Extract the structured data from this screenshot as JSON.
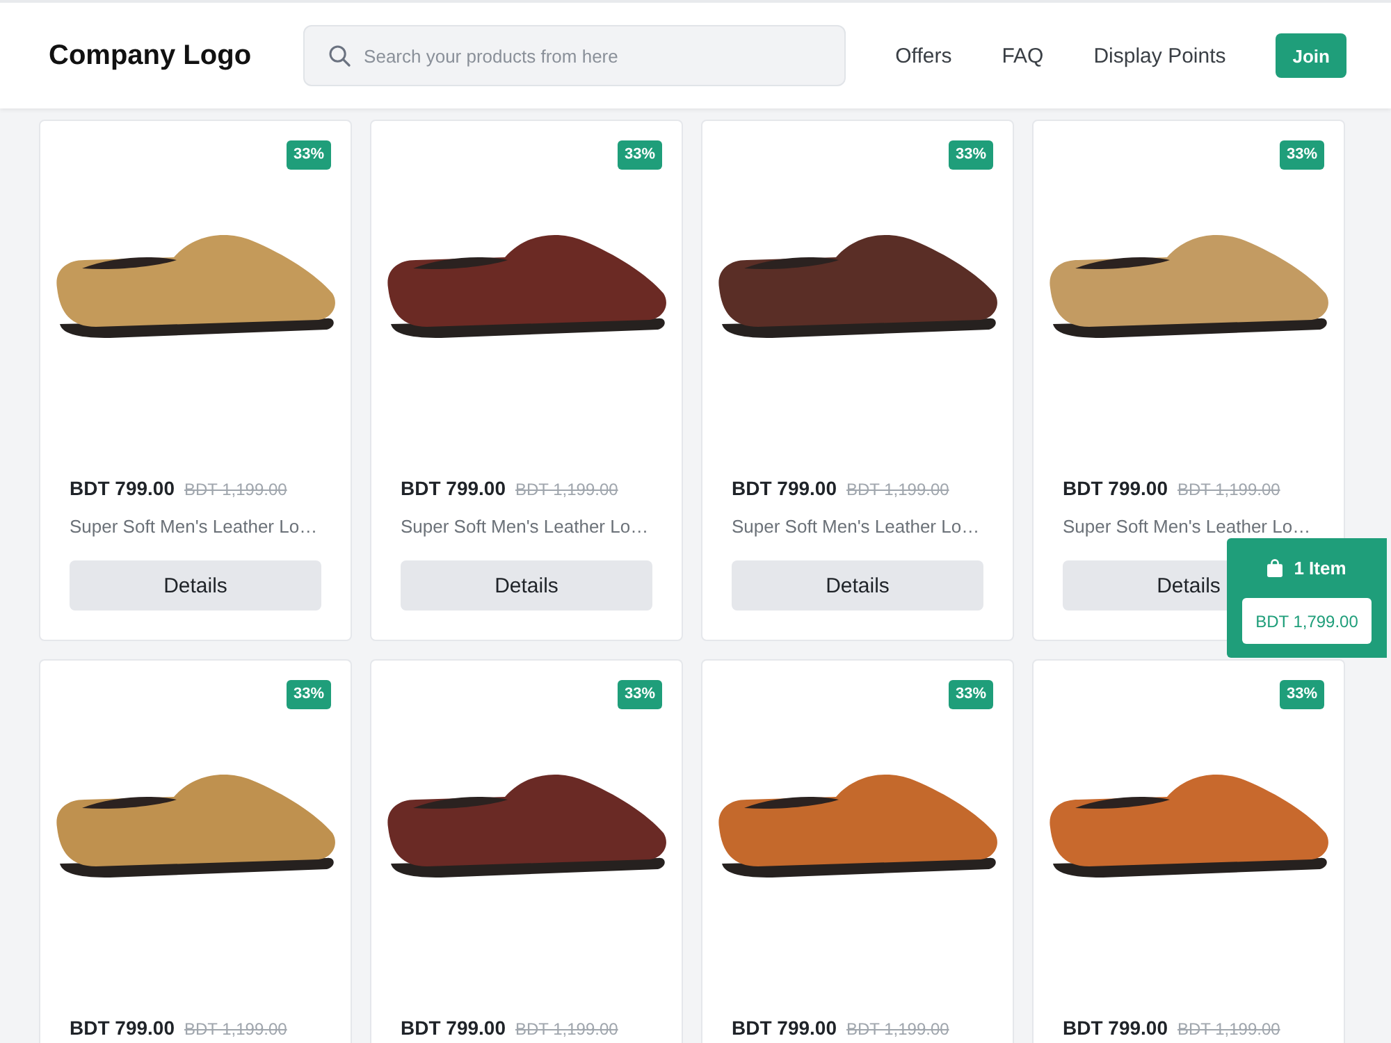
{
  "header": {
    "logo": "Company Logo",
    "search": {
      "placeholder": "Search your products from here"
    },
    "nav": [
      "Offers",
      "FAQ",
      "Display Points"
    ],
    "join_button": "Join"
  },
  "products": [
    {
      "badge": "33%",
      "color": "#c49a5a",
      "price": "BDT 799.00",
      "old_price": "BDT 1,199.00",
      "name": "Super Soft Men's Leather Lo…",
      "button": "Details"
    },
    {
      "badge": "33%",
      "color": "#6b2a24",
      "price": "BDT 799.00",
      "old_price": "BDT 1,199.00",
      "name": "Super Soft Men's Leather Lo…",
      "button": "Details"
    },
    {
      "badge": "33%",
      "color": "#5a2e26",
      "price": "BDT 799.00",
      "old_price": "BDT 1,199.00",
      "name": "Super Soft Men's Leather Lo…",
      "button": "Details"
    },
    {
      "badge": "33%",
      "color": "#c39b62",
      "price": "BDT 799.00",
      "old_price": "BDT 1,199.00",
      "name": "Super Soft Men's Leather Lo…",
      "button": "Details"
    },
    {
      "badge": "33%",
      "color": "#bf914f",
      "price": "BDT 799.00",
      "old_price": "BDT 1,199.00"
    },
    {
      "badge": "33%",
      "color": "#6a2a25",
      "price": "BDT 799.00",
      "old_price": "BDT 1,199.00"
    },
    {
      "badge": "33%",
      "color": "#c4692c",
      "price": "BDT 799.00",
      "old_price": "BDT 1,199.00"
    },
    {
      "badge": "33%",
      "color": "#c8692d",
      "price": "BDT 799.00",
      "old_price": "BDT 1,199.00"
    }
  ],
  "cart": {
    "count": "1 Item",
    "total": "BDT 1,799.00"
  }
}
